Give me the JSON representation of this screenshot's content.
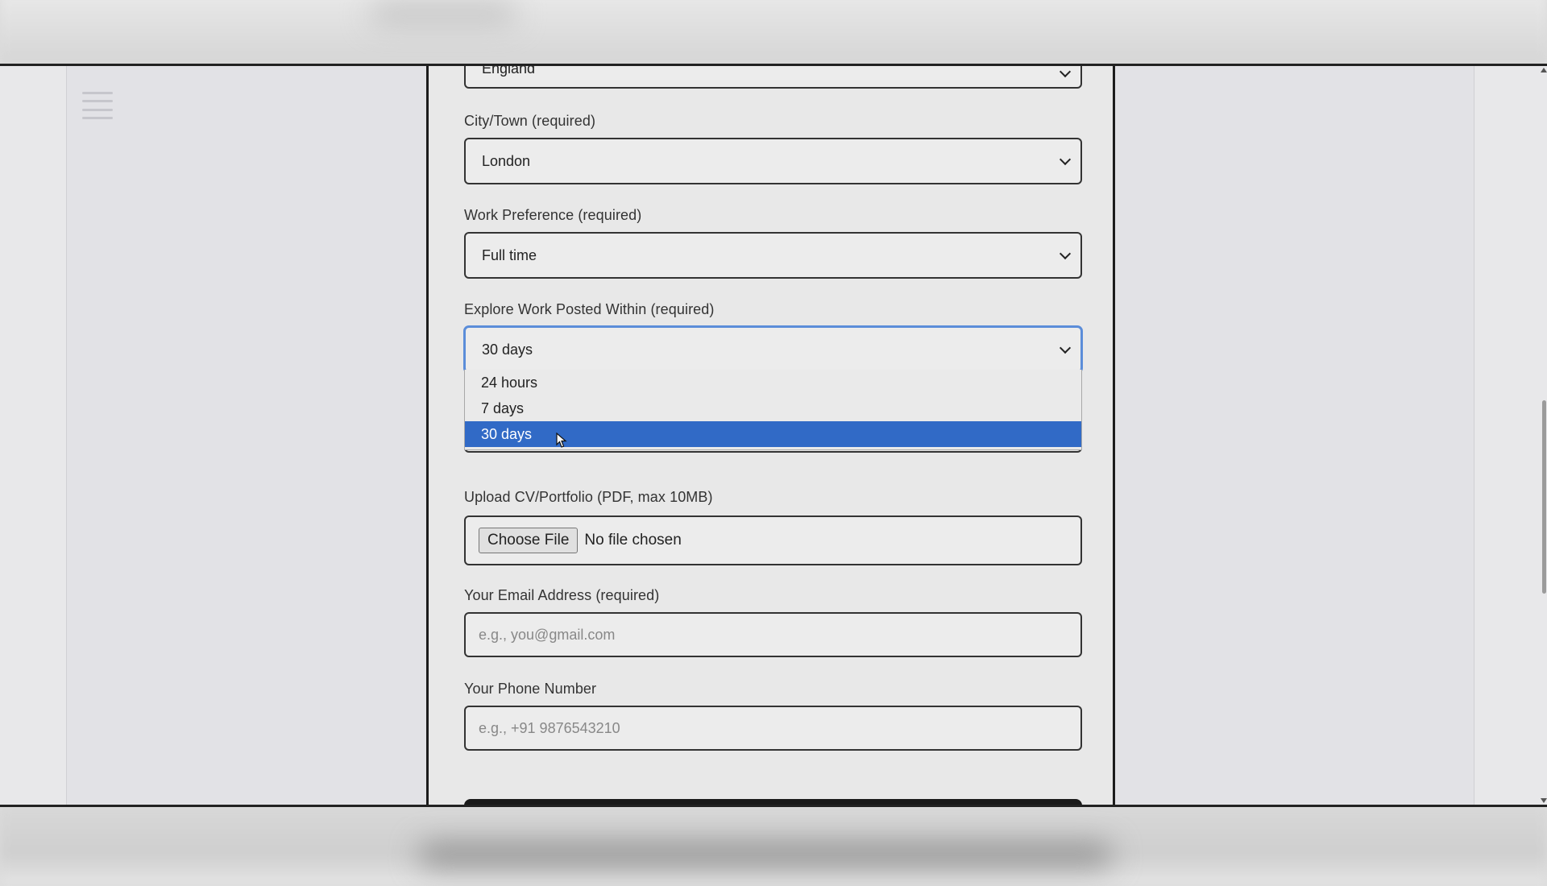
{
  "form": {
    "country_value": "England",
    "city": {
      "label": "City/Town (required)",
      "value": "London"
    },
    "work_preference": {
      "label": "Work Preference (required)",
      "value": "Full time"
    },
    "posted_within": {
      "label": "Explore Work Posted Within (required)",
      "value": "30 days",
      "options": [
        "24 hours",
        "7 days",
        "30 days"
      ],
      "highlighted": "30 days"
    },
    "upload": {
      "label": "Upload CV/Portfolio (PDF, max 10MB)",
      "button": "Choose File",
      "status": "No file chosen"
    },
    "email": {
      "label": "Your Email Address (required)",
      "placeholder": "e.g., you@gmail.com"
    },
    "phone": {
      "label": "Your Phone Number",
      "placeholder": "e.g., +91 9876543210"
    }
  },
  "icons": {
    "menu": "hamburger-menu-icon",
    "cursor": "mouse-pointer-icon"
  },
  "colors": {
    "highlight": "#316ac6",
    "focus_border": "#5b8dd9"
  }
}
